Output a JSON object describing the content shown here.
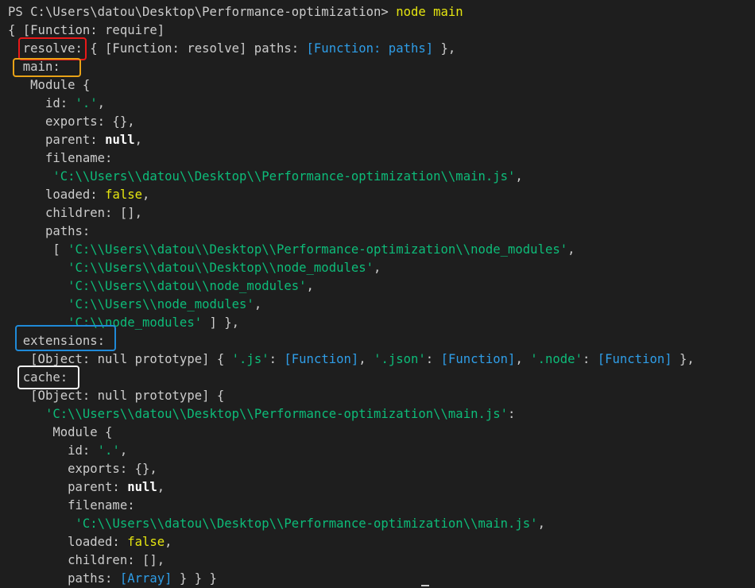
{
  "terminal": {
    "lines": [
      [
        {
          "t": "PS C:\\Users\\datou\\Desktop\\Performance-optimization> ",
          "c": "prompt"
        },
        {
          "t": "node main",
          "c": "cmd"
        }
      ],
      [
        {
          "t": "{ [Function: require]",
          "c": ""
        }
      ],
      [
        {
          "t": "  resolve: { [Function: resolve] paths: ",
          "c": ""
        },
        {
          "t": "[Function: paths]",
          "c": "link"
        },
        {
          "t": " },",
          "c": ""
        }
      ],
      [
        {
          "t": "  main:",
          "c": ""
        }
      ],
      [
        {
          "t": "   Module {",
          "c": ""
        }
      ],
      [
        {
          "t": "     id: ",
          "c": ""
        },
        {
          "t": "'.'",
          "c": "str"
        },
        {
          "t": ",",
          "c": ""
        }
      ],
      [
        {
          "t": "     exports: {},",
          "c": ""
        }
      ],
      [
        {
          "t": "     parent: ",
          "c": ""
        },
        {
          "t": "null",
          "c": "null"
        },
        {
          "t": ",",
          "c": ""
        }
      ],
      [
        {
          "t": "     filename:",
          "c": ""
        }
      ],
      [
        {
          "t": "      ",
          "c": ""
        },
        {
          "t": "'C:\\\\Users\\\\datou\\\\Desktop\\\\Performance-optimization\\\\main.js'",
          "c": "str"
        },
        {
          "t": ",",
          "c": ""
        }
      ],
      [
        {
          "t": "     loaded: ",
          "c": ""
        },
        {
          "t": "false",
          "c": "bool"
        },
        {
          "t": ",",
          "c": ""
        }
      ],
      [
        {
          "t": "     children: [],",
          "c": ""
        }
      ],
      [
        {
          "t": "     paths:",
          "c": ""
        }
      ],
      [
        {
          "t": "      [ ",
          "c": ""
        },
        {
          "t": "'C:\\\\Users\\\\datou\\\\Desktop\\\\Performance-optimization\\\\node_modules'",
          "c": "str"
        },
        {
          "t": ",",
          "c": ""
        }
      ],
      [
        {
          "t": "        ",
          "c": ""
        },
        {
          "t": "'C:\\\\Users\\\\datou\\\\Desktop\\\\node_modules'",
          "c": "str"
        },
        {
          "t": ",",
          "c": ""
        }
      ],
      [
        {
          "t": "        ",
          "c": ""
        },
        {
          "t": "'C:\\\\Users\\\\datou\\\\node_modules'",
          "c": "str"
        },
        {
          "t": ",",
          "c": ""
        }
      ],
      [
        {
          "t": "        ",
          "c": ""
        },
        {
          "t": "'C:\\\\Users\\\\node_modules'",
          "c": "str"
        },
        {
          "t": ",",
          "c": ""
        }
      ],
      [
        {
          "t": "        ",
          "c": ""
        },
        {
          "t": "'C:\\\\node_modules'",
          "c": "str"
        },
        {
          "t": " ] },",
          "c": ""
        }
      ],
      [
        {
          "t": "  extensions:",
          "c": ""
        }
      ],
      [
        {
          "t": "   [Object: null prototype] { ",
          "c": ""
        },
        {
          "t": "'.js'",
          "c": "str"
        },
        {
          "t": ": ",
          "c": ""
        },
        {
          "t": "[Function]",
          "c": "link"
        },
        {
          "t": ", ",
          "c": ""
        },
        {
          "t": "'.json'",
          "c": "str"
        },
        {
          "t": ": ",
          "c": ""
        },
        {
          "t": "[Function]",
          "c": "link"
        },
        {
          "t": ", ",
          "c": ""
        },
        {
          "t": "'.node'",
          "c": "str"
        },
        {
          "t": ": ",
          "c": ""
        },
        {
          "t": "[Function]",
          "c": "link"
        },
        {
          "t": " },",
          "c": ""
        }
      ],
      [
        {
          "t": "  cache:",
          "c": ""
        }
      ],
      [
        {
          "t": "   [Object: null prototype] {",
          "c": ""
        }
      ],
      [
        {
          "t": "     ",
          "c": ""
        },
        {
          "t": "'C:\\\\Users\\\\datou\\\\Desktop\\\\Performance-optimization\\\\main.js'",
          "c": "str"
        },
        {
          "t": ":",
          "c": ""
        }
      ],
      [
        {
          "t": "      Module {",
          "c": ""
        }
      ],
      [
        {
          "t": "        id: ",
          "c": ""
        },
        {
          "t": "'.'",
          "c": "str"
        },
        {
          "t": ",",
          "c": ""
        }
      ],
      [
        {
          "t": "        exports: {},",
          "c": ""
        }
      ],
      [
        {
          "t": "        parent: ",
          "c": ""
        },
        {
          "t": "null",
          "c": "null"
        },
        {
          "t": ",",
          "c": ""
        }
      ],
      [
        {
          "t": "        filename:",
          "c": ""
        }
      ],
      [
        {
          "t": "         ",
          "c": ""
        },
        {
          "t": "'C:\\\\Users\\\\datou\\\\Desktop\\\\Performance-optimization\\\\main.js'",
          "c": "str"
        },
        {
          "t": ",",
          "c": ""
        }
      ],
      [
        {
          "t": "        loaded: ",
          "c": ""
        },
        {
          "t": "false",
          "c": "bool"
        },
        {
          "t": ",",
          "c": ""
        }
      ],
      [
        {
          "t": "        children: [],",
          "c": ""
        }
      ],
      [
        {
          "t": "        paths: ",
          "c": ""
        },
        {
          "t": "[Array]",
          "c": "link"
        },
        {
          "t": " } } }",
          "c": ""
        }
      ]
    ]
  },
  "colors": {
    "background": "#1e1e1e",
    "text": "#cccccc",
    "string": "#0dbc79",
    "function_ref": "#2f9ee8",
    "command": "#e5e510",
    "boolean": "#e5e510",
    "highlight_resolve": "#e81919",
    "highlight_main": "#e8a217",
    "highlight_extensions": "#1f8ad8",
    "highlight_cache": "#f0f0f0"
  }
}
